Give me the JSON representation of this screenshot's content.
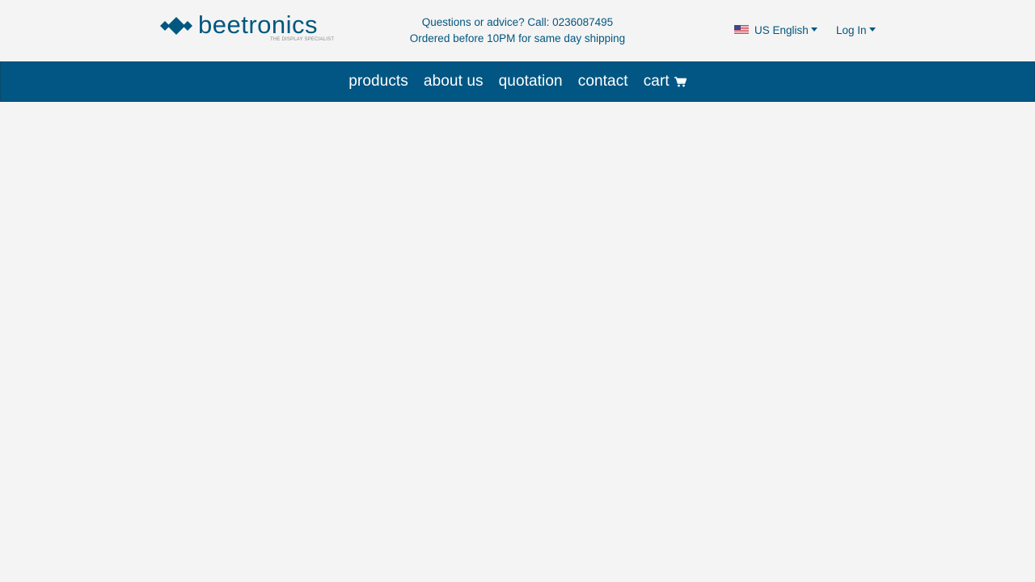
{
  "brand": {
    "name": "beetronics",
    "tagline": "THE DISPLAY SPECIALIST"
  },
  "contact": {
    "line1": "Questions or advice? Call: 0236087495",
    "line2": "Ordered before 10PM for same day shipping"
  },
  "language": {
    "label": "US English",
    "flag": "us-flag-icon"
  },
  "account": {
    "login_label": "Log In"
  },
  "nav": {
    "items": [
      {
        "label": "products"
      },
      {
        "label": "about us"
      },
      {
        "label": "quotation"
      },
      {
        "label": "contact"
      },
      {
        "label": "cart",
        "icon": "cart-icon"
      }
    ]
  },
  "colors": {
    "brand_blue": "#00577f",
    "nav_background": "#015683",
    "page_background": "#f4f4f4",
    "nav_text": "#ffffff"
  }
}
